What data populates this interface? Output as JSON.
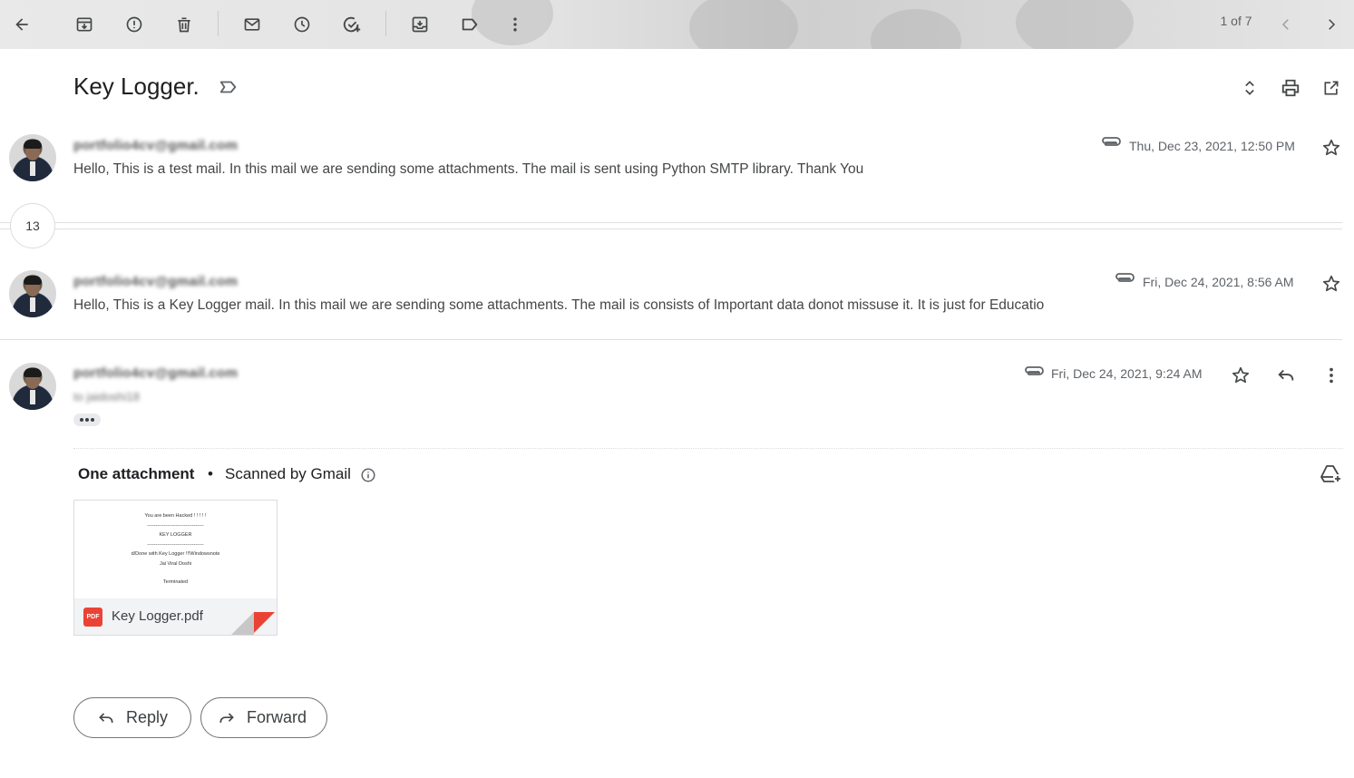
{
  "toolbar": {
    "pager": "1 of 7"
  },
  "thread": {
    "subject": "Key Logger.",
    "collapsed_count": "13"
  },
  "messages": [
    {
      "sender": "portfolio4cv@gmail.com",
      "snippet": "Hello, This is a test mail. In this mail we are sending some attachments. The mail is sent using Python SMTP library. Thank You",
      "date": "Thu, Dec 23, 2021, 12:50 PM"
    },
    {
      "sender": "portfolio4cv@gmail.com",
      "snippet": "Hello, This is a Key Logger mail. In this mail we are sending some attachments. The mail is consists of Important data donot missuse it. It is just for Educatio",
      "date": "Fri, Dec 24, 2021, 8:56 AM"
    },
    {
      "sender": "portfolio4cv@gmail.com",
      "to": "to jaidoshi18",
      "date": "Fri, Dec 24, 2021, 9:24 AM"
    }
  ],
  "attachments": {
    "title": "One attachment",
    "scanned": "Scanned by Gmail",
    "file": {
      "name": "Key Logger.pdf",
      "badge": "PDF",
      "preview_lines": [
        "You are been Hacked ! ! ! ! !",
        "----------------------------------",
        "KEY LOGGER",
        "----------------------------------",
        "d/Done with Key Logger !!!Windowsnote",
        "Jai Viral Doshi",
        "Terminated"
      ]
    }
  },
  "actions": {
    "reply": "Reply",
    "forward": "Forward"
  },
  "colors": {
    "accent_red": "#ea4335",
    "icon_gray": "#444746"
  }
}
